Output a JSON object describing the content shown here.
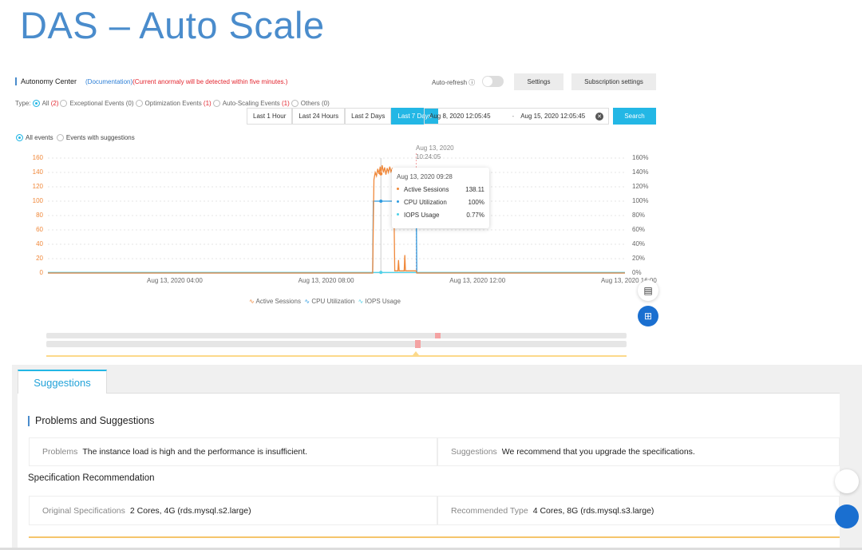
{
  "slide_title": "DAS – Auto Scale",
  "header": {
    "title": "Autonomy Center",
    "doc_link": "(Documentation)",
    "notice": "(Current anormaly will be detected within five minutes.)",
    "auto_refresh_label": "Auto-refresh",
    "auto_refresh_on": false,
    "settings_label": "Settings",
    "subscription_label": "Subscription settings"
  },
  "type_filter": {
    "label": "Type:",
    "options": [
      {
        "label": "All",
        "count": "(2)",
        "selected": true,
        "count_red": true
      },
      {
        "label": "Exceptional Events",
        "count": "(0)",
        "selected": false,
        "count_red": false
      },
      {
        "label": "Optimization Events",
        "count": "(1)",
        "selected": false,
        "count_red": true
      },
      {
        "label": "Auto-Scaling Events",
        "count": "(1)",
        "selected": false,
        "count_red": true
      },
      {
        "label": "Others",
        "count": "(0)",
        "selected": false,
        "count_red": false
      }
    ]
  },
  "time_ranges": [
    "Last 1 Hour",
    "Last 24 Hours",
    "Last 2 Days",
    "Last 7 Days"
  ],
  "time_range_selected": "Last 7 Days",
  "date_start": "Aug 8, 2020 12:05:45",
  "date_sep": "-",
  "date_end": "Aug 15, 2020 12:05:45",
  "search_label": "Search",
  "event_filter": [
    "All events",
    "Events with suggestions"
  ],
  "cursor_label": {
    "date": "Aug 13, 2020",
    "time": "10:24:05"
  },
  "tooltip": {
    "title": "Aug 13, 2020 09:28",
    "rows": [
      {
        "name": "Active Sessions",
        "value": "138.11",
        "color": "#f0883a"
      },
      {
        "name": "CPU Utilization",
        "value": "100%",
        "color": "#2d9be0"
      },
      {
        "name": "IOPS Usage",
        "value": "0.77%",
        "color": "#4fd1e8"
      }
    ]
  },
  "chart_data": {
    "type": "line",
    "xlim": [
      "00:40",
      "15:55"
    ],
    "x_ticks": [
      "Aug 13, 2020 04:00",
      "Aug 13, 2020 08:00",
      "Aug 13, 2020 12:00",
      "Aug 13, 2020 16:00"
    ],
    "x_tick_times": [
      "04:00",
      "08:00",
      "12:00",
      "16:00"
    ],
    "y_left": {
      "ticks": [
        "0",
        "20",
        "40",
        "60",
        "80",
        "100",
        "120",
        "140",
        "160"
      ],
      "range": [
        0,
        160
      ]
    },
    "y_right": {
      "ticks": [
        "0%",
        "20%",
        "40%",
        "60%",
        "80%",
        "100%",
        "120%",
        "140%",
        "160%"
      ],
      "range": [
        0,
        160
      ]
    },
    "grid": true,
    "legend_position": "bottom",
    "series": [
      {
        "name": "Active Sessions",
        "color": "#f0883a",
        "axis": "left",
        "points": [
          [
            "00:40",
            0
          ],
          [
            "09:15",
            0
          ],
          [
            "09:17",
            130
          ],
          [
            "09:19",
            140
          ],
          [
            "09:21",
            135
          ],
          [
            "09:23",
            145
          ],
          [
            "09:25",
            138
          ],
          [
            "09:27",
            148
          ],
          [
            "09:28",
            138
          ],
          [
            "09:30",
            150
          ],
          [
            "09:32",
            140
          ],
          [
            "09:34",
            147
          ],
          [
            "09:36",
            137
          ],
          [
            "09:38",
            146
          ],
          [
            "09:40",
            140
          ],
          [
            "09:42",
            148
          ],
          [
            "09:44",
            141
          ],
          [
            "09:46",
            145
          ],
          [
            "09:48",
            140
          ],
          [
            "09:50",
            3
          ],
          [
            "09:55",
            3
          ],
          [
            "09:56",
            18
          ],
          [
            "09:57",
            3
          ],
          [
            "10:05",
            3
          ],
          [
            "10:06",
            25
          ],
          [
            "10:07",
            3
          ],
          [
            "10:24",
            3
          ],
          [
            "10:25",
            0
          ],
          [
            "15:55",
            0
          ]
        ]
      },
      {
        "name": "CPU Utilization",
        "color": "#2d9be0",
        "axis": "right",
        "points": [
          [
            "00:40",
            0
          ],
          [
            "09:15",
            0
          ],
          [
            "09:16",
            100
          ],
          [
            "10:24",
            100
          ],
          [
            "10:25",
            0
          ],
          [
            "15:55",
            0
          ]
        ]
      },
      {
        "name": "IOPS Usage",
        "color": "#4fd1e8",
        "axis": "right",
        "points": [
          [
            "00:40",
            0.77
          ],
          [
            "15:55",
            0.77
          ]
        ]
      }
    ]
  },
  "suggestions": {
    "tab_label": "Suggestions",
    "section_title": "Problems and Suggestions",
    "problems_label": "Problems",
    "problems_value": "The instance load is high and the performance is insufficient.",
    "suggestions_label": "Suggestions",
    "suggestions_value": "We recommend that you upgrade the specifications.",
    "spec_title": "Specification Recommendation",
    "original_label": "Original Specifications",
    "original_value": "2 Cores, 4G (rds.mysql.s2.large)",
    "recommended_label": "Recommended Type",
    "recommended_value": "4 Cores, 8G (rds.mysql.s3.large)"
  }
}
